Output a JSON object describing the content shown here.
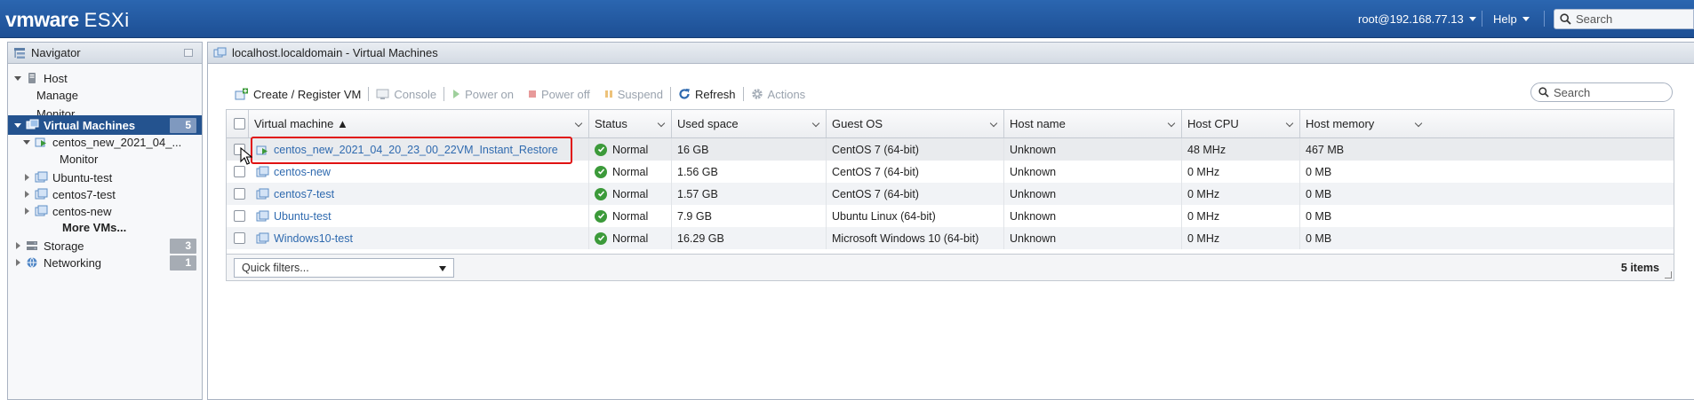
{
  "app": {
    "logo_vm": "vmware",
    "logo_product": "ESXi",
    "user": "root@192.168.77.13",
    "help": "Help",
    "search_placeholder": "Search",
    "colors": {
      "topbar": "#2b66b0",
      "selected": "#24538f",
      "link": "#2f6aaf",
      "ok": "#3c9a3a",
      "highlight": "#e01212"
    }
  },
  "navigator": {
    "title": "Navigator",
    "items": [
      {
        "label": "Host",
        "icon": "host-icon"
      },
      {
        "label": "Manage"
      },
      {
        "label": "Monitor"
      },
      {
        "label": "Virtual Machines",
        "count": "5",
        "icon": "vms-icon"
      },
      {
        "label": "centos_new_2021_04_...",
        "icon": "vm-running-icon"
      },
      {
        "label": "Monitor"
      },
      {
        "label": "Ubuntu-test",
        "icon": "vm-icon"
      },
      {
        "label": "centos7-test",
        "icon": "vm-icon"
      },
      {
        "label": "centos-new",
        "icon": "vm-icon"
      },
      {
        "label": "More VMs..."
      },
      {
        "label": "Storage",
        "count": "3",
        "icon": "storage-icon"
      },
      {
        "label": "Networking",
        "count": "1",
        "icon": "network-icon"
      }
    ]
  },
  "main": {
    "title": "localhost.localdomain - Virtual Machines",
    "toolbar": {
      "create": "Create / Register VM",
      "console": "Console",
      "power_on": "Power on",
      "power_off": "Power off",
      "suspend": "Suspend",
      "refresh": "Refresh",
      "actions": "Actions"
    },
    "search_placeholder": "Search",
    "columns": [
      "Virtual machine ▲",
      "Status",
      "Used space",
      "Guest OS",
      "Host name",
      "Host CPU",
      "Host memory"
    ],
    "rows": [
      {
        "name": "centos_new_2021_04_20_23_00_22VM_Instant_Restore",
        "status": "Normal",
        "used": "16 GB",
        "os": "CentOS 7 (64-bit)",
        "host": "Unknown",
        "cpu": "48 MHz",
        "mem": "467 MB",
        "icon": "vm-running-icon"
      },
      {
        "name": "centos-new",
        "status": "Normal",
        "used": "1.56 GB",
        "os": "CentOS 7 (64-bit)",
        "host": "Unknown",
        "cpu": "0 MHz",
        "mem": "0 MB",
        "icon": "vm-icon"
      },
      {
        "name": "centos7-test",
        "status": "Normal",
        "used": "1.57 GB",
        "os": "CentOS 7 (64-bit)",
        "host": "Unknown",
        "cpu": "0 MHz",
        "mem": "0 MB",
        "icon": "vm-icon"
      },
      {
        "name": "Ubuntu-test",
        "status": "Normal",
        "used": "7.9 GB",
        "os": "Ubuntu Linux (64-bit)",
        "host": "Unknown",
        "cpu": "0 MHz",
        "mem": "0 MB",
        "icon": "vm-icon"
      },
      {
        "name": "Windows10-test",
        "status": "Normal",
        "used": "16.29 GB",
        "os": "Microsoft Windows 10 (64-bit)",
        "host": "Unknown",
        "cpu": "0 MHz",
        "mem": "0 MB",
        "icon": "vm-icon"
      }
    ],
    "quick_filters": "Quick filters...",
    "item_count": "5 items"
  }
}
